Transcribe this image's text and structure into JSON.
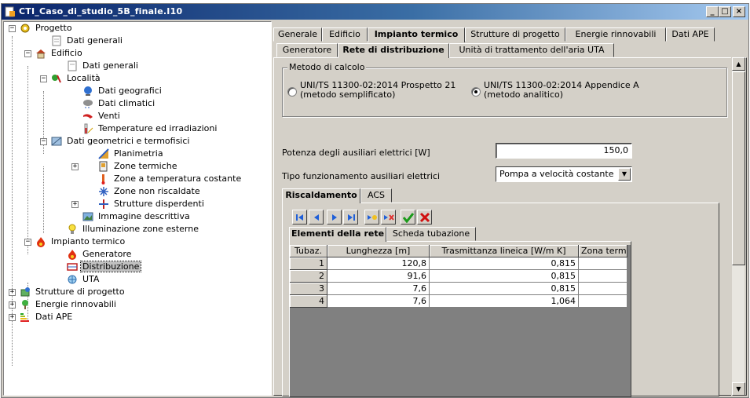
{
  "window": {
    "title": "CTI_Caso_di_studio_5B_finale.I10"
  },
  "window_buttons": {
    "minimize": "_",
    "maximize": "□",
    "close": "×"
  },
  "tree": {
    "root": "Progetto",
    "dati_generali": "Dati generali",
    "edificio": "Edificio",
    "edificio_dati_generali": "Dati generali",
    "localita": "Località",
    "dati_geografici": "Dati geografici",
    "dati_climatici": "Dati climatici",
    "venti": "Venti",
    "temperature": "Temperature ed irradiazioni",
    "dati_geometrici": "Dati geometrici e termofisici",
    "planimetria": "Planimetria",
    "zone_termiche": "Zone termiche",
    "zone_temp_costante": "Zone a temperatura costante",
    "zone_non_riscaldate": "Zone non riscaldate",
    "strutture_disperdenti": "Strutture disperdenti",
    "immagine_descrittiva": "Immagine descrittiva",
    "illuminazione": "Illuminazione zone esterne",
    "impianto_termico": "Impianto termico",
    "generatore": "Generatore",
    "distribuzione": "Distribuzione",
    "uta": "UTA",
    "strutture_progetto": "Strutture di progetto",
    "energie_rinnovabili": "Energie rinnovabili",
    "dati_ape": "Dati APE"
  },
  "main_tabs": [
    "Generale",
    "Edificio",
    "Impianto termico",
    "Strutture di progetto",
    "Energie rinnovabili",
    "Dati APE"
  ],
  "sub_tabs": [
    "Generatore",
    "Rete di distribuzione",
    "Unità di trattamento dell'aria UTA"
  ],
  "metodo": {
    "legend": "Metodo di calcolo",
    "option1_line1": "UNI/TS 11300-02:2014 Prospetto 21",
    "option1_line2": "(metodo semplificato)",
    "option2_line1": "UNI/TS 11300-02:2014 Appendice A",
    "option2_line2": "(metodo analitico)",
    "selected": 2
  },
  "potenza": {
    "label": "Potenza degli ausiliari elettrici [W]",
    "value": "150,0"
  },
  "tipo": {
    "label": "Tipo funzionamento ausiliari elettrici",
    "value": "Pompa a velocità costante"
  },
  "service_tabs": [
    "Riscaldamento",
    "ACS"
  ],
  "inner_tabs": [
    "Elementi della rete",
    "Scheda tubazione"
  ],
  "grid": {
    "headers": [
      "Tubaz.",
      "Lunghezza [m]",
      "Trasmittanza lineica [W/m K]",
      "Zona term."
    ],
    "rows": [
      [
        "1",
        "120,8",
        "0,815",
        ""
      ],
      [
        "2",
        "91,6",
        "0,815",
        ""
      ],
      [
        "3",
        "7,6",
        "0,815",
        ""
      ],
      [
        "4",
        "7,6",
        "1,064",
        ""
      ]
    ]
  },
  "colors": {
    "title_start": "#0a246a",
    "title_end": "#a6caf0",
    "face": "#d4d0c8",
    "confirm": "#1a9a1a",
    "cancel": "#d01010",
    "nav": "#1f5fd8"
  },
  "icons": [
    "app-icon",
    "project-icon",
    "document-icon",
    "house-icon",
    "location-icon",
    "globe-icon",
    "climate-icon",
    "wind-icon",
    "thermometer-icon",
    "geometry-icon",
    "planimetry-icon",
    "zones-icon",
    "zone-constant-icon",
    "snowflake-icon",
    "structure-icon",
    "image-icon",
    "lightbulb-icon",
    "fire-icon",
    "distribution-icon",
    "fan-icon",
    "renewable-icon",
    "ape-icon"
  ]
}
